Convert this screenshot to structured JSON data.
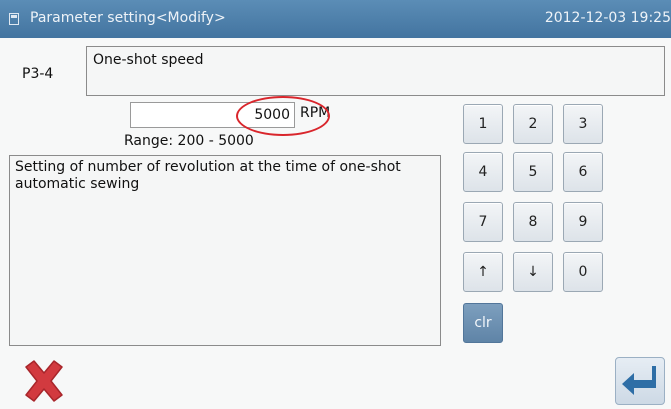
{
  "header": {
    "title": "Parameter setting<Modify>",
    "datetime": "2012-12-03  19:25"
  },
  "parameter": {
    "code": "P3-4",
    "name": "One-shot speed",
    "value": "5000",
    "unit": "RPM",
    "range_label": "Range: 200  -  5000",
    "description": "Setting of number of revolution at the time of one-shot automatic sewing"
  },
  "keypad": {
    "keys": [
      "1",
      "2",
      "3",
      "4",
      "5",
      "6",
      "7",
      "8",
      "9",
      "↑",
      "↓",
      "0",
      "clr"
    ]
  },
  "footer": {
    "cancel_icon": "x-icon",
    "enter_icon": "enter-return-icon"
  },
  "colors": {
    "titlebar": "#4d7fa8",
    "highlight": "#d9262c",
    "cancel": "#d23a3f",
    "enter": "#2e6ea6"
  }
}
